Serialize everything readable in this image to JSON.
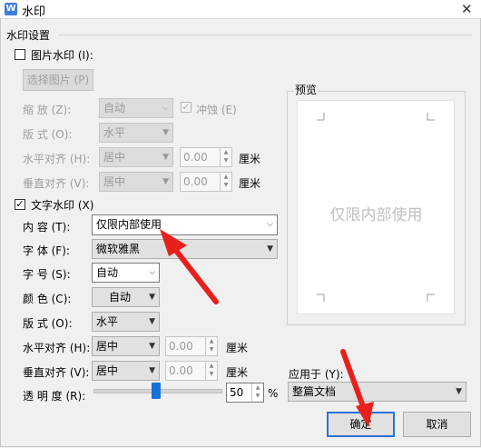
{
  "window": {
    "title": "水印",
    "app_icon_glyph": "W"
  },
  "section_title": "水印设置",
  "picture_watermark": {
    "checkbox_label": "图片水印 (I):",
    "checked": false,
    "select_picture_button": "选择图片 (P)",
    "scale_label": "缩    放 (Z):",
    "scale_value": "自动",
    "washout_label": "冲蚀 (E)",
    "washout_checked": true,
    "layout_label": "版    式 (O):",
    "layout_value": "水平",
    "h_align_label": "水平对齐 (H):",
    "h_align_value": "居中",
    "h_offset": "0.00",
    "v_align_label": "垂直对齐 (V):",
    "v_align_value": "居中",
    "v_offset": "0.00",
    "unit": "厘米"
  },
  "text_watermark": {
    "checkbox_label": "文字水印 (X)",
    "checked": true,
    "content_label": "内    容 (T):",
    "content_value": "仅限内部使用",
    "font_label": "字    体 (F):",
    "font_value": "微软雅黑",
    "size_label": "字    号 (S):",
    "size_value": "自动",
    "color_label": "颜    色 (C):",
    "color_value": "自动",
    "layout_label": "版    式 (O):",
    "layout_value": "水平",
    "h_align_label": "水平对齐 (H):",
    "h_align_value": "居中",
    "h_offset": "0.00",
    "v_align_label": "垂直对齐 (V):",
    "v_align_value": "居中",
    "v_offset": "0.00",
    "unit": "厘米",
    "transparency_label": "透 明 度 (R):",
    "transparency_value": "50",
    "transparency_fraction": 0.5,
    "percent_sign": "%"
  },
  "preview": {
    "title": "预览",
    "watermark_text": "仅限内部使用"
  },
  "apply_to": {
    "label": "应用于 (Y):",
    "value": "整篇文档"
  },
  "buttons": {
    "ok": "确定",
    "cancel": "取消"
  },
  "colors": {
    "accent": "#1573d6",
    "annotation_arrow": "#e8201c"
  }
}
